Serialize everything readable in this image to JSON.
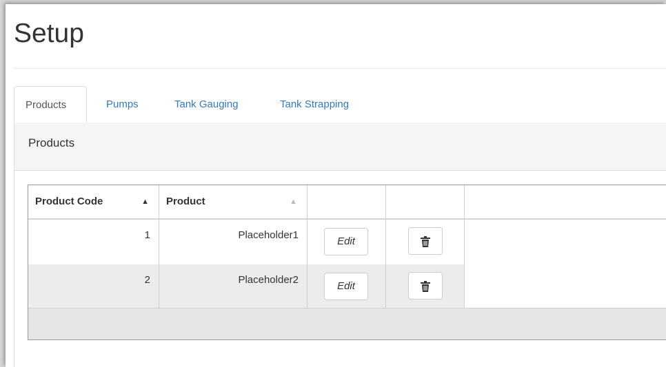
{
  "page": {
    "title": "Setup"
  },
  "tabs": [
    {
      "label": "Products",
      "active": true
    },
    {
      "label": "Pumps",
      "active": false
    },
    {
      "label": "Tank Gauging",
      "active": false
    },
    {
      "label": "Tank Strapping",
      "active": false
    }
  ],
  "panel": {
    "heading": "Products"
  },
  "grid": {
    "columns": [
      {
        "label": "Product Code",
        "sort": "ascending"
      },
      {
        "label": "Product",
        "sort": "inactive"
      }
    ],
    "rows": [
      {
        "code": "1",
        "product": "Placeholder1",
        "edit_label": "Edit"
      },
      {
        "code": "2",
        "product": "Placeholder2",
        "edit_label": "Edit"
      }
    ]
  },
  "colors": {
    "link": "#337ab7",
    "alt_row": "#ececec",
    "footer": "#e6e6e6"
  },
  "icons": {
    "sort_asc": "sort-ascending-icon",
    "delete": "trash-icon"
  }
}
